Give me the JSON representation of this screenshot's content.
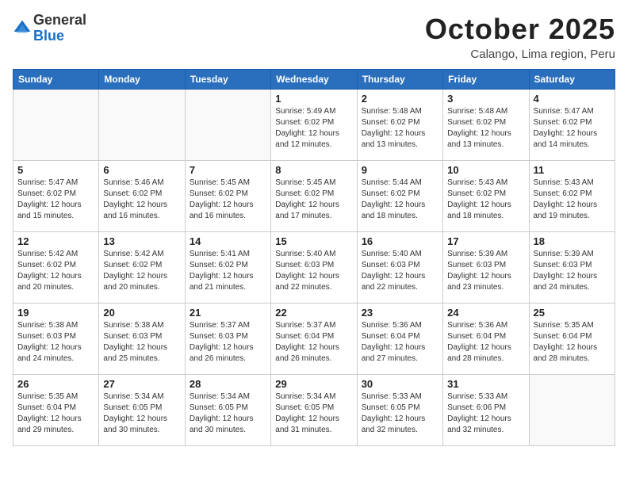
{
  "logo": {
    "general": "General",
    "blue": "Blue"
  },
  "title": {
    "month": "October 2025",
    "location": "Calango, Lima region, Peru"
  },
  "days_of_week": [
    "Sunday",
    "Monday",
    "Tuesday",
    "Wednesday",
    "Thursday",
    "Friday",
    "Saturday"
  ],
  "weeks": [
    [
      {
        "day": "",
        "info": ""
      },
      {
        "day": "",
        "info": ""
      },
      {
        "day": "",
        "info": ""
      },
      {
        "day": "1",
        "info": "Sunrise: 5:49 AM\nSunset: 6:02 PM\nDaylight: 12 hours and 12 minutes."
      },
      {
        "day": "2",
        "info": "Sunrise: 5:48 AM\nSunset: 6:02 PM\nDaylight: 12 hours and 13 minutes."
      },
      {
        "day": "3",
        "info": "Sunrise: 5:48 AM\nSunset: 6:02 PM\nDaylight: 12 hours and 13 minutes."
      },
      {
        "day": "4",
        "info": "Sunrise: 5:47 AM\nSunset: 6:02 PM\nDaylight: 12 hours and 14 minutes."
      }
    ],
    [
      {
        "day": "5",
        "info": "Sunrise: 5:47 AM\nSunset: 6:02 PM\nDaylight: 12 hours and 15 minutes."
      },
      {
        "day": "6",
        "info": "Sunrise: 5:46 AM\nSunset: 6:02 PM\nDaylight: 12 hours and 16 minutes."
      },
      {
        "day": "7",
        "info": "Sunrise: 5:45 AM\nSunset: 6:02 PM\nDaylight: 12 hours and 16 minutes."
      },
      {
        "day": "8",
        "info": "Sunrise: 5:45 AM\nSunset: 6:02 PM\nDaylight: 12 hours and 17 minutes."
      },
      {
        "day": "9",
        "info": "Sunrise: 5:44 AM\nSunset: 6:02 PM\nDaylight: 12 hours and 18 minutes."
      },
      {
        "day": "10",
        "info": "Sunrise: 5:43 AM\nSunset: 6:02 PM\nDaylight: 12 hours and 18 minutes."
      },
      {
        "day": "11",
        "info": "Sunrise: 5:43 AM\nSunset: 6:02 PM\nDaylight: 12 hours and 19 minutes."
      }
    ],
    [
      {
        "day": "12",
        "info": "Sunrise: 5:42 AM\nSunset: 6:02 PM\nDaylight: 12 hours and 20 minutes."
      },
      {
        "day": "13",
        "info": "Sunrise: 5:42 AM\nSunset: 6:02 PM\nDaylight: 12 hours and 20 minutes."
      },
      {
        "day": "14",
        "info": "Sunrise: 5:41 AM\nSunset: 6:02 PM\nDaylight: 12 hours and 21 minutes."
      },
      {
        "day": "15",
        "info": "Sunrise: 5:40 AM\nSunset: 6:03 PM\nDaylight: 12 hours and 22 minutes."
      },
      {
        "day": "16",
        "info": "Sunrise: 5:40 AM\nSunset: 6:03 PM\nDaylight: 12 hours and 22 minutes."
      },
      {
        "day": "17",
        "info": "Sunrise: 5:39 AM\nSunset: 6:03 PM\nDaylight: 12 hours and 23 minutes."
      },
      {
        "day": "18",
        "info": "Sunrise: 5:39 AM\nSunset: 6:03 PM\nDaylight: 12 hours and 24 minutes."
      }
    ],
    [
      {
        "day": "19",
        "info": "Sunrise: 5:38 AM\nSunset: 6:03 PM\nDaylight: 12 hours and 24 minutes."
      },
      {
        "day": "20",
        "info": "Sunrise: 5:38 AM\nSunset: 6:03 PM\nDaylight: 12 hours and 25 minutes."
      },
      {
        "day": "21",
        "info": "Sunrise: 5:37 AM\nSunset: 6:03 PM\nDaylight: 12 hours and 26 minutes."
      },
      {
        "day": "22",
        "info": "Sunrise: 5:37 AM\nSunset: 6:04 PM\nDaylight: 12 hours and 26 minutes."
      },
      {
        "day": "23",
        "info": "Sunrise: 5:36 AM\nSunset: 6:04 PM\nDaylight: 12 hours and 27 minutes."
      },
      {
        "day": "24",
        "info": "Sunrise: 5:36 AM\nSunset: 6:04 PM\nDaylight: 12 hours and 28 minutes."
      },
      {
        "day": "25",
        "info": "Sunrise: 5:35 AM\nSunset: 6:04 PM\nDaylight: 12 hours and 28 minutes."
      }
    ],
    [
      {
        "day": "26",
        "info": "Sunrise: 5:35 AM\nSunset: 6:04 PM\nDaylight: 12 hours and 29 minutes."
      },
      {
        "day": "27",
        "info": "Sunrise: 5:34 AM\nSunset: 6:05 PM\nDaylight: 12 hours and 30 minutes."
      },
      {
        "day": "28",
        "info": "Sunrise: 5:34 AM\nSunset: 6:05 PM\nDaylight: 12 hours and 30 minutes."
      },
      {
        "day": "29",
        "info": "Sunrise: 5:34 AM\nSunset: 6:05 PM\nDaylight: 12 hours and 31 minutes."
      },
      {
        "day": "30",
        "info": "Sunrise: 5:33 AM\nSunset: 6:05 PM\nDaylight: 12 hours and 32 minutes."
      },
      {
        "day": "31",
        "info": "Sunrise: 5:33 AM\nSunset: 6:06 PM\nDaylight: 12 hours and 32 minutes."
      },
      {
        "day": "",
        "info": ""
      }
    ]
  ]
}
